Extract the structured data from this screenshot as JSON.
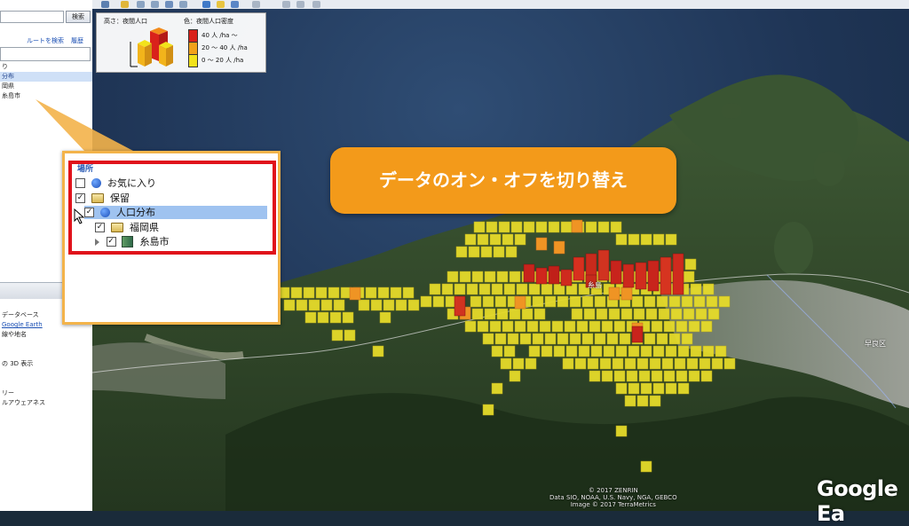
{
  "sidebar": {
    "search_button": "検索",
    "route_link": "ルートを検索",
    "history_link": "履歴",
    "places_lines": [
      {
        "label": "り",
        "selected": false
      },
      {
        "label": "分布",
        "selected": true
      },
      {
        "label": "岡県",
        "selected": false
      },
      {
        "label": "糸島市",
        "selected": false
      }
    ],
    "layer_lines": [
      {
        "label": "データベース",
        "link": false
      },
      {
        "label": "Google Earth",
        "link": true
      },
      {
        "label": "線や地名",
        "link": false
      },
      {
        "label": "",
        "link": false
      },
      {
        "label": "",
        "link": false
      },
      {
        "label": "の 3D 表示",
        "link": false
      },
      {
        "label": "",
        "link": false
      },
      {
        "label": "",
        "link": false
      },
      {
        "label": "リー",
        "link": false
      },
      {
        "label": "ルアウェアネス",
        "link": false
      },
      {
        "label": "",
        "link": false
      }
    ]
  },
  "legend": {
    "height_label": "高さ：夜間人口",
    "color_label": "色：夜間人口密度",
    "rows": [
      "40 人 /ha ～",
      "20 ～ 40 人 /ha",
      "0 ～ 20 人 /ha"
    ],
    "colors": [
      "#d9221b",
      "#f2a21b",
      "#f2e21b"
    ]
  },
  "callout": {
    "text": "データのオン・オフを切り替え",
    "color": "#f39a1a"
  },
  "zoom_panel": {
    "header": "場所",
    "items": [
      {
        "label": "お気に入り",
        "checked": false,
        "icon": "swirl-icon",
        "indent": 0,
        "selected": false
      },
      {
        "label": "保留",
        "checked": true,
        "icon": "folder-icon",
        "indent": 0,
        "selected": false
      },
      {
        "label": "人口分布",
        "checked": true,
        "icon": "swirl-icon",
        "indent": 1,
        "selected": true
      },
      {
        "label": "福岡県",
        "checked": true,
        "icon": "folder-icon",
        "indent": 2,
        "selected": false
      },
      {
        "label": "糸島市",
        "checked": true,
        "icon": "bldg-icon",
        "indent": 3,
        "selected": false
      }
    ]
  },
  "map": {
    "city_label": "糸島",
    "district_label": "早良区",
    "attribution": [
      "© 2017 ZENRIN",
      "Data SIO, NOAA, U.S. Navy, NGA, GEBCO",
      "Image © 2017 TerraMetrics"
    ],
    "logo": "Google Ea"
  }
}
